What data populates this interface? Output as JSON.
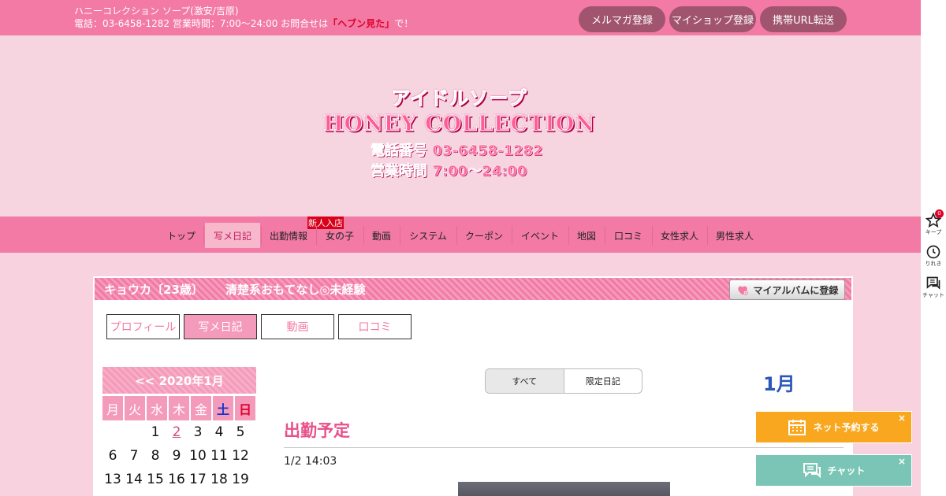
{
  "topbar": {
    "line1": "ハニーコレクション ソープ(激安/吉原)",
    "line2_prefix": "電話：03-6458-1282 営業時間：7:00～24:00 お問合せは",
    "line2_highlight": "「ヘブン見た」",
    "line2_suffix": "で！",
    "buttons": [
      "メルマガ登録",
      "マイショップ登録",
      "携帯URL転送"
    ]
  },
  "logo": {
    "line1": "アイドルソープ",
    "line2": "HONEY COLLECTION",
    "line3": "電話番号 03-6458-1282",
    "line4": "営業時間 7:00～24:00"
  },
  "nav": {
    "items": [
      "トップ",
      "写メ日記",
      "出勤情報",
      "女の子",
      "動画",
      "システム",
      "クーポン",
      "イベント",
      "地図",
      "口コミ",
      "女性求人",
      "男性求人"
    ],
    "active": "写メ日記",
    "badge": "新人入店"
  },
  "sidebar": {
    "keep_label": "キープ",
    "keep_count": "0",
    "history_label": "りれき",
    "chat_label": "チャット"
  },
  "profile": {
    "name": "キョウカ〔23歳〕",
    "catch": "清楚系おもてなし◎未経験",
    "album_button": "マイアルバムに登録",
    "tabs": [
      "プロフィール",
      "写メ日記",
      "動画",
      "口コミ"
    ],
    "active_tab": "写メ日記"
  },
  "calendar": {
    "header": "<< 2020年1月",
    "dows": [
      "月",
      "火",
      "水",
      "木",
      "金",
      "土",
      "日"
    ],
    "weeks": [
      [
        "",
        "",
        "1",
        "2",
        "3",
        "4",
        "5"
      ],
      [
        "6",
        "7",
        "8",
        "9",
        "10",
        "11",
        "12"
      ],
      [
        "13",
        "14",
        "15",
        "16",
        "17",
        "18",
        "19"
      ]
    ],
    "linked_day": "2"
  },
  "diary": {
    "filters": [
      "すべて",
      "限定日記"
    ],
    "month": "1月",
    "entry_title": "出勤予定",
    "entry_date": "1/2 14:03"
  },
  "floating": {
    "reserve": "ネット予約する",
    "chat": "チャット",
    "close": "×"
  },
  "colors": {
    "pink": "#f27aa4",
    "light_pink": "#f6d5e0",
    "reserve_orange": "#f9a71f",
    "chat_teal": "#7ac5b5"
  }
}
